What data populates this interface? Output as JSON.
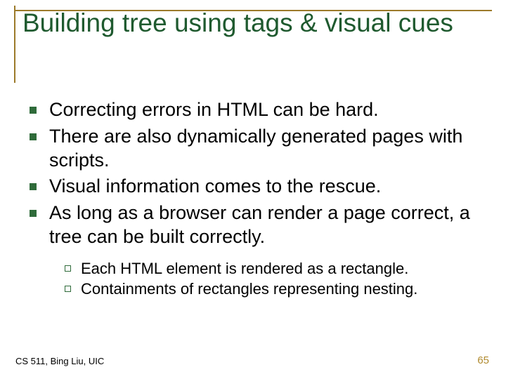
{
  "title": "Building tree using tags & visual cues",
  "bullets": [
    "Correcting errors in HTML can be hard.",
    "There are also dynamically generated pages with scripts.",
    "Visual information comes to the rescue.",
    "As long as a browser can render a page correct, a tree can be built correctly."
  ],
  "sub_bullets": [
    "Each HTML element is rendered as a rectangle.",
    "Containments of rectangles representing nesting."
  ],
  "footer_left": "CS 511, Bing Liu, UIC",
  "footer_right": "65"
}
